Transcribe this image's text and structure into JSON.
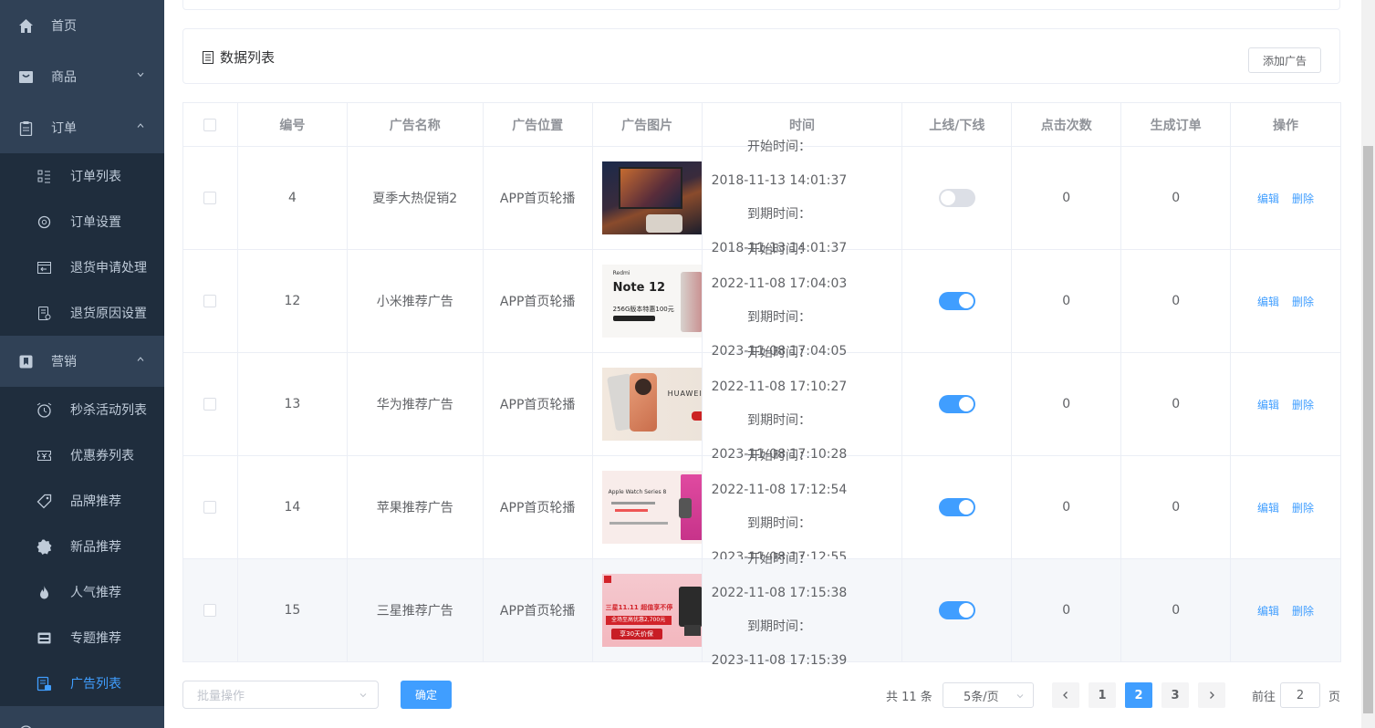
{
  "sidebar": {
    "items": [
      {
        "label": "首页",
        "icon": "home-icon"
      },
      {
        "label": "商品",
        "icon": "bag-icon"
      },
      {
        "label": "订单",
        "icon": "clipboard-icon"
      },
      {
        "label": "订单列表",
        "icon": "list-icon"
      },
      {
        "label": "订单设置",
        "icon": "gear-icon"
      },
      {
        "label": "退货申请处理",
        "icon": "return-icon"
      },
      {
        "label": "退货原因设置",
        "icon": "doc-settings-icon"
      },
      {
        "label": "营销",
        "icon": "bookmark-icon"
      },
      {
        "label": "秒杀活动列表",
        "icon": "clock-icon"
      },
      {
        "label": "优惠券列表",
        "icon": "coupon-icon"
      },
      {
        "label": "品牌推荐",
        "icon": "tag-icon"
      },
      {
        "label": "新品推荐",
        "icon": "new-badge-icon"
      },
      {
        "label": "人气推荐",
        "icon": "hot-icon"
      },
      {
        "label": "专题推荐",
        "icon": "topic-icon"
      },
      {
        "label": "广告列表",
        "icon": "ad-icon"
      }
    ],
    "active_color": "#409eff"
  },
  "toolbar": {
    "title": "数据列表",
    "add_label": "添加广告"
  },
  "table": {
    "headers": [
      "编号",
      "广告名称",
      "广告位置",
      "广告图片",
      "时间",
      "上线/下线",
      "点击次数",
      "生成订单",
      "操作"
    ],
    "start_prefix": "开始时间：",
    "end_prefix": "到期时间：",
    "edit_label": "编辑",
    "delete_label": "删除",
    "rows": [
      {
        "id": "4",
        "name": "夏季大热促销2",
        "position": "APP首页轮播",
        "start": "2018-11-13 14:01:37",
        "end": "2018-11-13 14:01:37",
        "online": false,
        "clicks": "0",
        "orders": "0"
      },
      {
        "id": "12",
        "name": "小米推荐广告",
        "position": "APP首页轮播",
        "start": "2022-11-08 17:04:03",
        "end": "2023-11-08 17:04:05",
        "online": true,
        "clicks": "0",
        "orders": "0"
      },
      {
        "id": "13",
        "name": "华为推荐广告",
        "position": "APP首页轮播",
        "start": "2022-11-08 17:10:27",
        "end": "2023-11-08 17:10:28",
        "online": true,
        "clicks": "0",
        "orders": "0"
      },
      {
        "id": "14",
        "name": "苹果推荐广告",
        "position": "APP首页轮播",
        "start": "2022-11-08 17:12:54",
        "end": "2023-11-08 17:12:55",
        "online": true,
        "clicks": "0",
        "orders": "0"
      },
      {
        "id": "15",
        "name": "三星推荐广告",
        "position": "APP首页轮播",
        "start": "2022-11-08 17:15:38",
        "end": "2023-11-08 17:15:39",
        "online": true,
        "clicks": "0",
        "orders": "0"
      }
    ]
  },
  "thumbs": {
    "xiaomi_brand": "Redmi",
    "xiaomi_model": "Note 12",
    "xiaomi_offer": "256G版本特惠100元",
    "huawei_brand": "HUAWEI",
    "apple_model": "Apple Watch Series 8",
    "samsung_banner": "三星11.11 超值享不停",
    "samsung_price": "全场至高优惠2,700元",
    "samsung_guarantee": "享30天价保"
  },
  "footer": {
    "batch_placeholder": "批量操作",
    "confirm_label": "确定",
    "total_text": "共 11 条",
    "page_size": "5条/页",
    "pages": [
      "1",
      "2",
      "3"
    ],
    "current_page": "2",
    "goto_label": "前往",
    "goto_value": "2",
    "page_suffix": "页"
  }
}
